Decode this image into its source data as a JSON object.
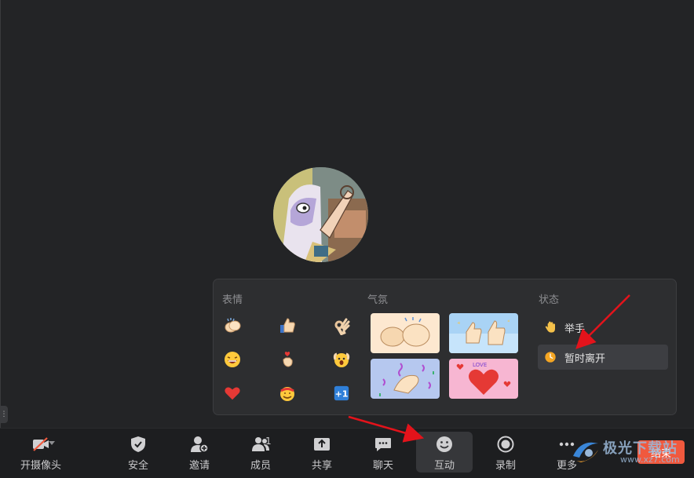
{
  "panel": {
    "emoji_title": "表情",
    "atmosphere_title": "气氛",
    "status_title": "状态",
    "emojis": [
      "clapping-hands",
      "thumbs-up",
      "ok-hand",
      "laughing-face",
      "finger-heart",
      "surprised-face",
      "red-heart",
      "celebration-face",
      "plus-one"
    ],
    "stickers": [
      "clapping-sticker",
      "thumbs-up-sticker",
      "call-me-sticker",
      "hearts-sticker"
    ],
    "status": {
      "raise_hand": "举手",
      "away": "暂时离开"
    }
  },
  "toolbar": {
    "camera": "开摄像头",
    "security": "安全",
    "invite": "邀请",
    "members": "成员",
    "members_count": "1",
    "share": "共享",
    "chat": "聊天",
    "interact": "互动",
    "record": "录制",
    "more": "更多",
    "end": "结束"
  },
  "watermark": {
    "brand": "极光下载站",
    "url": "www.xz7.com"
  },
  "colors": {
    "background": "#232426",
    "panel": "#2d2e30",
    "toolbar": "#1d1e20",
    "end_button": "#f0593e",
    "annotation_arrow": "#e3131b"
  }
}
